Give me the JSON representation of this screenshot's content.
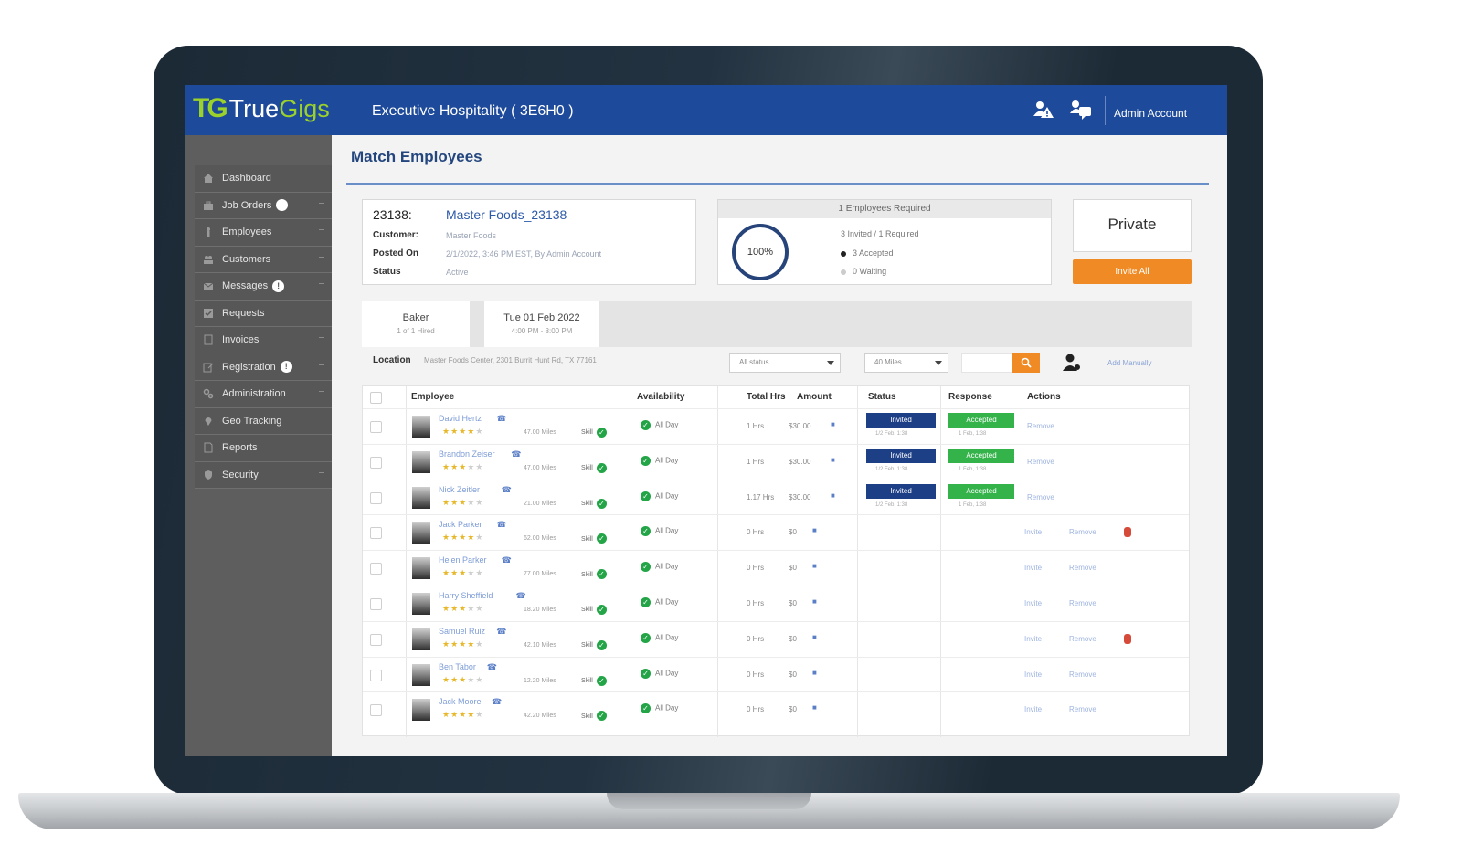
{
  "app": {
    "logo_mark": "TG",
    "logo_true": "True",
    "logo_gigs": "Gigs",
    "company": "Executive Hospitality ( 3E6H0 )",
    "admin_label": "Admin Account",
    "icons": [
      "person-alert-icon",
      "person-chat-icon"
    ]
  },
  "sidebar": {
    "items": [
      {
        "label": "Dashboard",
        "icon": "home-icon",
        "badge": ""
      },
      {
        "label": "Job Orders",
        "icon": "briefcase-icon",
        "badge": ""
      },
      {
        "label": "Employees",
        "icon": "person-icon",
        "badge": ""
      },
      {
        "label": "Customers",
        "icon": "people-icon",
        "badge": ""
      },
      {
        "label": "Messages",
        "icon": "mail-icon",
        "badge": "!"
      },
      {
        "label": "Requests",
        "icon": "check-icon",
        "badge": ""
      },
      {
        "label": "Invoices",
        "icon": "document-icon",
        "badge": ""
      },
      {
        "label": "Registration",
        "icon": "edit-icon",
        "badge": "!"
      },
      {
        "label": "Administration",
        "icon": "gears-icon",
        "badge": ""
      },
      {
        "label": "Geo Tracking",
        "icon": "map-pin-icon",
        "badge": ""
      },
      {
        "label": "Reports",
        "icon": "file-icon",
        "badge": ""
      },
      {
        "label": "Security",
        "icon": "shield-icon",
        "badge": ""
      }
    ]
  },
  "page": {
    "title": "Match Employees"
  },
  "job": {
    "id": "23138:",
    "name": "Master Foods_23138",
    "customer_label": "Customer:",
    "customer_value": "Master Foods",
    "posted_label": "Posted On",
    "posted_value": "2/1/2022, 3:46 PM EST, By Admin Account",
    "status_label": "Status",
    "status_value": "Active"
  },
  "employees_required": {
    "header": "1 Employees Required",
    "progress_label": "100%",
    "progress_value": 100,
    "line1": "3 Invited / 1 Required",
    "line2": "3 Accepted",
    "line3": "0 Waiting",
    "colors": {
      "ring": "#26437a",
      "accepted_dot": "#222222",
      "waiting_dot": "#cccccc"
    }
  },
  "visibility": {
    "label": "Private",
    "invite_all": "Invite All"
  },
  "tabs": [
    {
      "title": "Baker",
      "sub": "1 of 1 Hired"
    },
    {
      "title": "Tue 01 Feb 2022",
      "sub": "4:00 PM - 8:00 PM"
    }
  ],
  "filters": {
    "location_label": "Location",
    "location_value": "Master Foods Center, 2301 Burrit Hunt Rd, TX 77161",
    "status_select": "All status",
    "miles_select": "40 Miles",
    "search_placeholder": "",
    "manual_link": "Add Manually"
  },
  "table": {
    "headers": {
      "employee": "Employee",
      "availability": "Availability",
      "total_hrs": "Total Hrs",
      "amount": "Amount",
      "status": "Status",
      "response": "Response",
      "actions": "Actions"
    },
    "rows": [
      {
        "name": "David Hertz",
        "rating": 4,
        "miles": "47.00 Miles",
        "skill": "Skill",
        "availability": "All Day",
        "hours": "1 Hrs",
        "amount": "$30.00",
        "status": "Invited",
        "status_sub": "1/2 Feb, 1:38",
        "response": "Accepted",
        "response_sub": "1 Feb, 1:38",
        "actions": [
          "Remove"
        ],
        "flag": false
      },
      {
        "name": "Brandon Zeiser",
        "rating": 3,
        "miles": "47.00 Miles",
        "skill": "Skill",
        "availability": "All Day",
        "hours": "1 Hrs",
        "amount": "$30.00",
        "status": "Invited",
        "status_sub": "1/2 Feb, 1:38",
        "response": "Accepted",
        "response_sub": "1 Feb, 1:38",
        "actions": [
          "Remove"
        ],
        "flag": false
      },
      {
        "name": "Nick Zeitler",
        "rating": 3,
        "miles": "21.00 Miles",
        "skill": "Skill",
        "availability": "All Day",
        "hours": "1.17 Hrs",
        "amount": "$30.00",
        "status": "Invited",
        "status_sub": "1/2 Feb, 1:38",
        "response": "Accepted",
        "response_sub": "1 Feb, 1:38",
        "actions": [
          "Remove"
        ],
        "flag": false
      },
      {
        "name": "Jack Parker",
        "rating": 4,
        "miles": "62.00 Miles",
        "skill": "Skill",
        "availability": "All Day",
        "hours": "0 Hrs",
        "amount": "$0",
        "status": "",
        "status_sub": "",
        "response": "",
        "response_sub": "",
        "actions": [
          "Invite",
          "Remove"
        ],
        "flag": true
      },
      {
        "name": "Helen Parker",
        "rating": 3,
        "miles": "77.00 Miles",
        "skill": "Skill",
        "availability": "All Day",
        "hours": "0 Hrs",
        "amount": "$0",
        "status": "",
        "status_sub": "",
        "response": "",
        "response_sub": "",
        "actions": [
          "Invite",
          "Remove"
        ],
        "flag": false
      },
      {
        "name": "Harry Sheffield",
        "rating": 3,
        "miles": "18.20 Miles",
        "skill": "Skill",
        "availability": "All Day",
        "hours": "0 Hrs",
        "amount": "$0",
        "status": "",
        "status_sub": "",
        "response": "",
        "response_sub": "",
        "actions": [
          "Invite",
          "Remove"
        ],
        "flag": false
      },
      {
        "name": "Samuel Ruiz",
        "rating": 4,
        "miles": "42.10 Miles",
        "skill": "Skill",
        "availability": "All Day",
        "hours": "0 Hrs",
        "amount": "$0",
        "status": "",
        "status_sub": "",
        "response": "",
        "response_sub": "",
        "actions": [
          "Invite",
          "Remove"
        ],
        "flag": true
      },
      {
        "name": "Ben Tabor",
        "rating": 3,
        "miles": "12.20 Miles",
        "skill": "Skill",
        "availability": "All Day",
        "hours": "0 Hrs",
        "amount": "$0",
        "status": "",
        "status_sub": "",
        "response": "",
        "response_sub": "",
        "actions": [
          "Invite",
          "Remove"
        ],
        "flag": false
      },
      {
        "name": "Jack Moore",
        "rating": 4,
        "miles": "42.20 Miles",
        "skill": "Skill",
        "availability": "All Day",
        "hours": "0 Hrs",
        "amount": "$0",
        "status": "",
        "status_sub": "",
        "response": "",
        "response_sub": "",
        "actions": [
          "Invite",
          "Remove"
        ],
        "flag": false
      }
    ]
  },
  "colors": {
    "header_blue": "#1d4a9a",
    "brand_green": "#9bd12b",
    "accent_orange": "#f08a24",
    "invited_blue": "#1d3f86",
    "accepted_green": "#34b34a",
    "sidebar_gray": "#5e5e5e"
  }
}
